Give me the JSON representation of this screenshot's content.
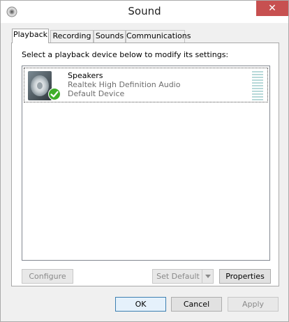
{
  "window": {
    "title": "Sound",
    "close_glyph": "✕"
  },
  "tabs": [
    {
      "label": "Playback",
      "active": true
    },
    {
      "label": "Recording",
      "active": false
    },
    {
      "label": "Sounds",
      "active": false
    },
    {
      "label": "Communications",
      "active": false
    }
  ],
  "playback": {
    "instruction": "Select a playback device below to modify its settings:",
    "devices": [
      {
        "name": "Speakers",
        "driver": "Realtek High Definition Audio",
        "status": "Default Device",
        "icon": "speaker-icon",
        "badge": "default-check-icon"
      }
    ],
    "buttons": {
      "configure": "Configure",
      "set_default": "Set Default",
      "properties": "Properties"
    }
  },
  "dialog_buttons": {
    "ok": "OK",
    "cancel": "Cancel",
    "apply": "Apply"
  },
  "colors": {
    "close": "#c75050",
    "check": "#3fae2a",
    "meter": "#b7d9d9"
  }
}
